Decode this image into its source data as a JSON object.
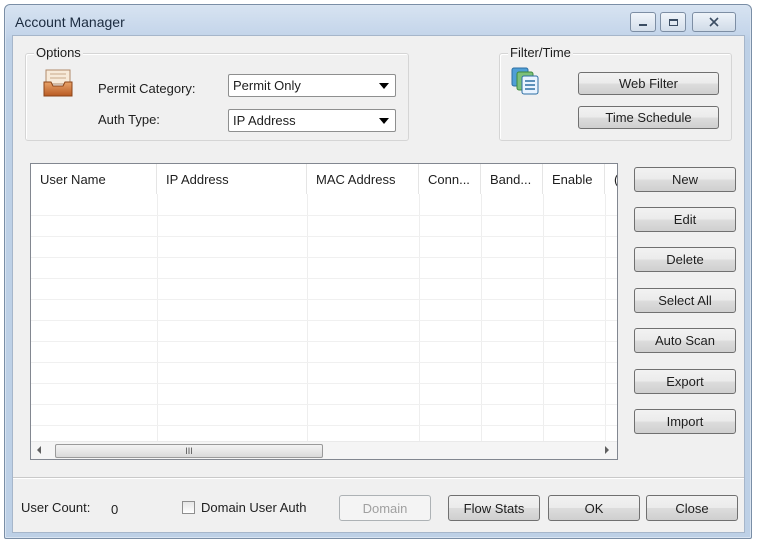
{
  "window": {
    "title": "Account Manager"
  },
  "options": {
    "caption": "Options",
    "permit_category_label": "Permit Category:",
    "permit_category_value": "Permit Only",
    "auth_type_label": "Auth Type:",
    "auth_type_value": "IP Address"
  },
  "filter_time": {
    "caption": "Filter/Time",
    "web_filter_label": "Web Filter",
    "time_schedule_label": "Time Schedule"
  },
  "list": {
    "columns": [
      "User Name",
      "IP Address",
      "MAC Address",
      "Conn...",
      "Band...",
      "Enable",
      "("
    ],
    "scroll_thumb_grip": "III"
  },
  "side_buttons": {
    "new": "New",
    "edit": "Edit",
    "delete": "Delete",
    "select_all": "Select All",
    "auto_scan": "Auto Scan",
    "export": "Export",
    "import": "Import"
  },
  "footer": {
    "user_count_label": "User Count:",
    "user_count_value": "0",
    "domain_user_auth_label": "Domain User Auth",
    "domain_label": "Domain",
    "flow_stats_label": "Flow Stats",
    "ok_label": "OK",
    "close_label": "Close"
  }
}
